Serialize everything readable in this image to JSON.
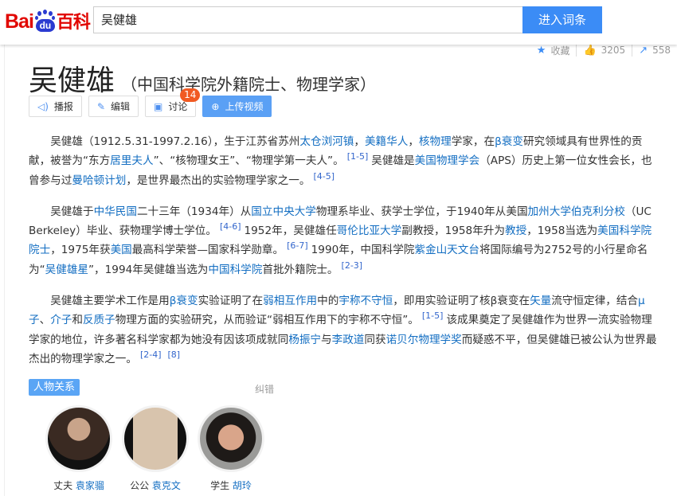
{
  "header": {
    "logo_text": "Baidu百科",
    "logo_bai": "Bai",
    "logo_du": "du",
    "logo_baike": "百科",
    "search_value": "吴健雄",
    "search_button": "进入词条"
  },
  "stats": {
    "collect_label": "收藏",
    "likes": "3205",
    "shares": "558"
  },
  "title": "吴健雄",
  "subtitle": "（中国科学院外籍院士、物理学家）",
  "actions": {
    "broadcast": "播报",
    "edit": "编辑",
    "discuss": "讨论",
    "discuss_count": "14",
    "upload_video": "上传视频"
  },
  "paragraphs": [
    [
      {
        "t": "吴健雄（1912.5.31-1997.2.16），生于江苏省苏州"
      },
      {
        "t": "太仓浏河镇",
        "link": true
      },
      {
        "t": "，"
      },
      {
        "t": "美籍华人",
        "link": true
      },
      {
        "t": "，"
      },
      {
        "t": "核物理",
        "link": true
      },
      {
        "t": "学家，在"
      },
      {
        "t": "β衰变",
        "link": true
      },
      {
        "t": "研究领域具有世界性的贡献，被誉为“东方"
      },
      {
        "t": "居里夫人",
        "link": true
      },
      {
        "t": "”、“核物理女王”、“物理学第一夫人”。"
      },
      {
        "t": "[1-5]",
        "sup": true
      },
      {
        "t": "吴健雄是"
      },
      {
        "t": "美国物理学会",
        "link": true
      },
      {
        "t": "（APS）历史上第一位女性会长，也曾参与过"
      },
      {
        "t": "曼哈顿计划",
        "link": true
      },
      {
        "t": "，是世界最杰出的实验物理学家之一。"
      },
      {
        "t": "[4-5]",
        "sup": true
      }
    ],
    [
      {
        "t": "吴健雄于"
      },
      {
        "t": "中华民国",
        "link": true
      },
      {
        "t": "二十三年（1934年）从"
      },
      {
        "t": "国立中央大学",
        "link": true
      },
      {
        "t": "物理系毕业、获学士学位，于1940年从美国"
      },
      {
        "t": "加州大学伯克利分校",
        "link": true
      },
      {
        "t": "（UC Berkeley）毕业、获物理学博士学位。"
      },
      {
        "t": "[4-6]",
        "sup": true
      },
      {
        "t": "1952年，吴健雄任"
      },
      {
        "t": "哥伦比亚大学",
        "link": true
      },
      {
        "t": "副教授，1958年升为"
      },
      {
        "t": "教授",
        "link": true
      },
      {
        "t": "，1958当选为"
      },
      {
        "t": "美国科学院院士",
        "link": true
      },
      {
        "t": "，1975年获"
      },
      {
        "t": "美国",
        "link": true
      },
      {
        "t": "最高科学荣誉—国家科学勋章。"
      },
      {
        "t": "[6-7]",
        "sup": true
      },
      {
        "t": "1990年，中国科学院"
      },
      {
        "t": "紫金山天文台",
        "link": true
      },
      {
        "t": "将国际编号为2752号的小行星命名为“"
      },
      {
        "t": "吴健雄星",
        "link": true
      },
      {
        "t": "”，1994年吴健雄当选为"
      },
      {
        "t": "中国科学院",
        "link": true
      },
      {
        "t": "首批外籍院士。"
      },
      {
        "t": "[2-3]",
        "sup": true
      }
    ],
    [
      {
        "t": "吴健雄主要学术工作是用"
      },
      {
        "t": "β衰变",
        "link": true
      },
      {
        "t": "实验证明了在"
      },
      {
        "t": "弱相互作用",
        "link": true
      },
      {
        "t": "中的"
      },
      {
        "t": "宇称不守恒",
        "link": true
      },
      {
        "t": "，即用实验证明了核β衰变在"
      },
      {
        "t": "矢量",
        "link": true
      },
      {
        "t": "流守恒定律，结合"
      },
      {
        "t": "μ子",
        "link": true
      },
      {
        "t": "、"
      },
      {
        "t": "介子",
        "link": true
      },
      {
        "t": "和"
      },
      {
        "t": "反质子",
        "link": true
      },
      {
        "t": "物理方面的实验研究，从而验证“弱相互作用下的宇称不守恒”。"
      },
      {
        "t": "[1-5]",
        "sup": true
      },
      {
        "t": "该成果奠定了吴健雄作为世界一流实验物理学家的地位，许多著名科学家都为她没有因该项成就同"
      },
      {
        "t": "杨振宁",
        "link": true
      },
      {
        "t": "与"
      },
      {
        "t": "李政道",
        "link": true
      },
      {
        "t": "同获"
      },
      {
        "t": "诺贝尔物理学奖",
        "link": true
      },
      {
        "t": "而疑惑不平，但吴健雄已被公认为世界最杰出的物理学家之一。"
      },
      {
        "t": "[2-4]",
        "sup": true
      },
      {
        "t": "[8]",
        "sup": true
      }
    ]
  ],
  "relations": {
    "tag": "人物关系",
    "fix": "纠错",
    "people": [
      {
        "relation": "丈夫",
        "name": "袁家骝"
      },
      {
        "relation": "公公",
        "name": "袁克文"
      },
      {
        "relation": "学生",
        "name": "胡玲"
      }
    ]
  },
  "colors": {
    "accent": "#3b8cf6",
    "link": "#136ec2",
    "logo_red": "#e10601",
    "logo_blue": "#2b3bd1",
    "badge": "#f15a22"
  }
}
